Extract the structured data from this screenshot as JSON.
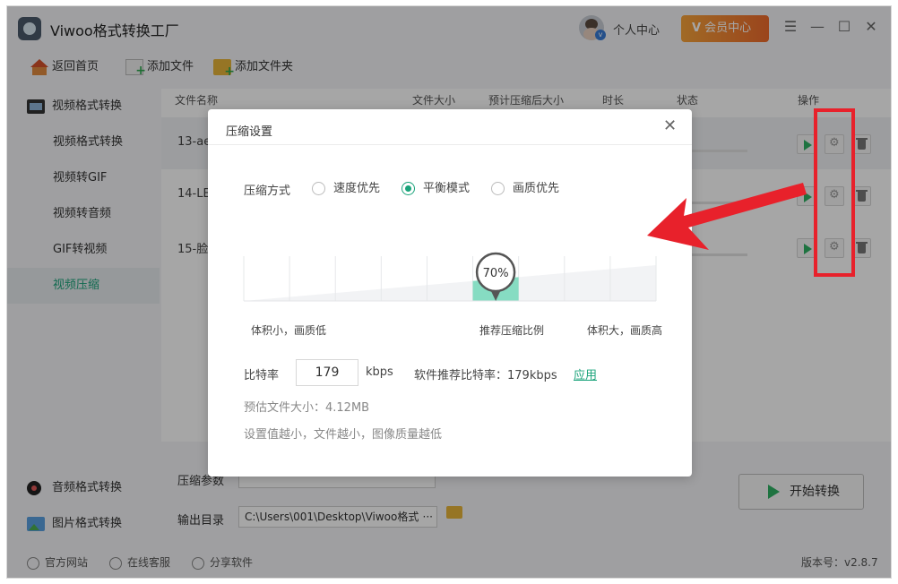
{
  "app": {
    "title": "Viwoo格式转换工厂",
    "user_center": "个人中心",
    "member_center": "会员中心",
    "win_menu": "☰",
    "win_min": "—",
    "win_max": "☐",
    "win_close": "✕"
  },
  "toolbar": {
    "home": "返回首页",
    "add_file": "添加文件",
    "add_folder": "添加文件夹"
  },
  "sidebar": {
    "video_format": "视频格式转换",
    "items": [
      "视频格式转换",
      "视频转GIF",
      "视频转音频",
      "GIF转视频",
      "视频压缩"
    ],
    "audio_format": "音频格式转换",
    "image_format": "图片格式转换"
  },
  "table": {
    "headers": [
      "文件名称",
      "文件大小",
      "预计压缩后大小",
      "时长",
      "状态",
      "操作"
    ],
    "rows": [
      {
        "name": "13-ae"
      },
      {
        "name": "14-LE"
      },
      {
        "name": "15-脸"
      }
    ]
  },
  "bottom": {
    "compress_param_label": "压缩参数",
    "output_dir_label": "输出目录",
    "output_path": "C:\\Users\\001\\Desktop\\Viwoo格式",
    "output_path_more": "···",
    "start_button": "开始转换"
  },
  "footer": {
    "website": "官方网站",
    "service": "在线客服",
    "share": "分享软件",
    "version": "版本号：v2.8.7"
  },
  "dialog": {
    "title": "压缩设置",
    "close": "✕",
    "mode_label": "压缩方式",
    "modes": [
      "速度优先",
      "平衡模式",
      "画质优先"
    ],
    "selected_mode": "平衡模式",
    "ratio_value": "70%",
    "ratio_percent": 70,
    "cap_low": "体积小，画质低",
    "cap_mid": "推荐压缩比例",
    "cap_high": "体积大，画质高",
    "bitrate_label": "比特率",
    "bitrate_value": "179",
    "bitrate_unit": "kbps",
    "recommend": "软件推荐比特率：179kbps",
    "apply": "应用",
    "estimate": "预估文件大小：4.12MB",
    "hint": "设置值越小，文件越小，图像质量越低"
  },
  "colors": {
    "accent": "#1aa37a",
    "slider_fill": "#86dcc2",
    "annotation_red": "#e8212b",
    "member_orange": "#ef7a30"
  }
}
